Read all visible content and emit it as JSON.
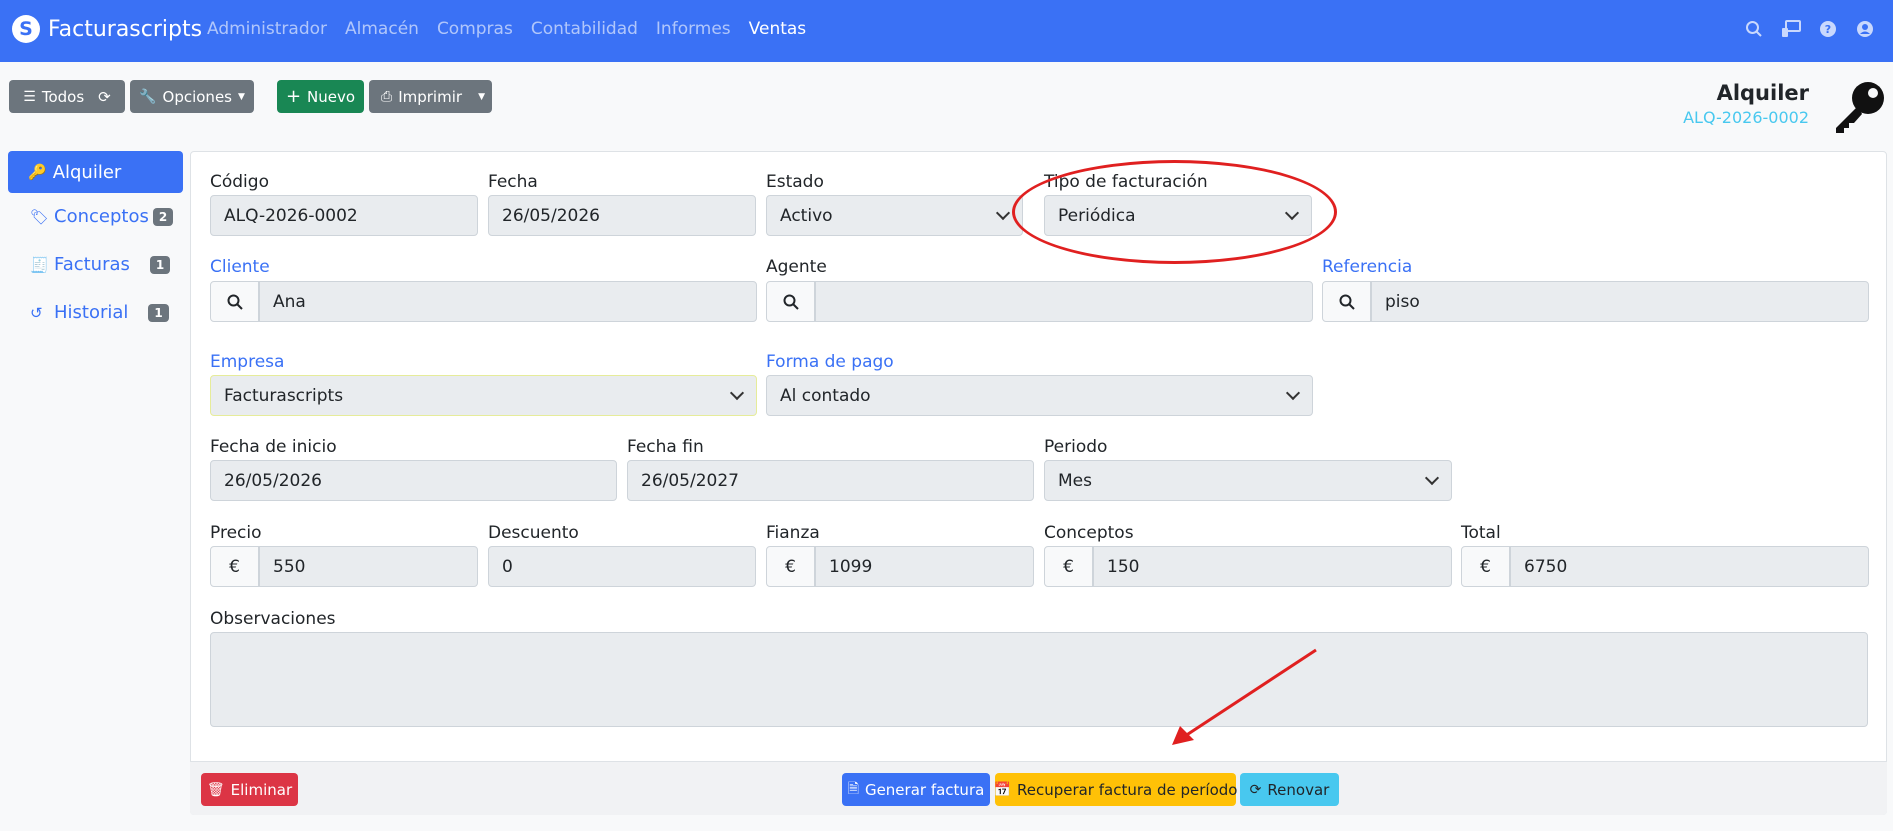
{
  "navbar": {
    "brand": "Facturascripts",
    "menu": [
      "Administrador",
      "Almacén",
      "Compras",
      "Contabilidad",
      "Informes",
      "Ventas"
    ],
    "active_menu": "Ventas",
    "icons": [
      "search-icon",
      "monitor-icon",
      "help-icon",
      "user-icon"
    ]
  },
  "toolbar": {
    "all_label": "Todos",
    "options_label": "Opciones",
    "new_label": "Nuevo",
    "print_label": "Imprimir"
  },
  "header": {
    "title": "Alquiler",
    "code": "ALQ-2026-0002"
  },
  "sidebar": {
    "items": [
      {
        "label": "Alquiler",
        "icon": "key-icon",
        "active": true
      },
      {
        "label": "Conceptos",
        "icon": "tags-icon",
        "badge": "2"
      },
      {
        "label": "Facturas",
        "icon": "invoice-icon",
        "badge": "1"
      },
      {
        "label": "Historial",
        "icon": "history-icon",
        "badge": "1"
      }
    ]
  },
  "form": {
    "codigo": {
      "label": "Código",
      "value": "ALQ-2026-0002"
    },
    "fecha": {
      "label": "Fecha",
      "value": "26/05/2026"
    },
    "estado": {
      "label": "Estado",
      "value": "Activo"
    },
    "tipo_facturacion": {
      "label": "Tipo de facturación",
      "value": "Periódica"
    },
    "cliente": {
      "label": "Cliente",
      "value": "Ana"
    },
    "agente": {
      "label": "Agente",
      "value": ""
    },
    "referencia": {
      "label": "Referencia",
      "value": "piso"
    },
    "empresa": {
      "label": "Empresa",
      "value": "Facturascripts"
    },
    "forma_pago": {
      "label": "Forma de pago",
      "value": "Al contado"
    },
    "fecha_inicio": {
      "label": "Fecha de inicio",
      "value": "26/05/2026"
    },
    "fecha_fin": {
      "label": "Fecha fin",
      "value": "26/05/2027"
    },
    "periodo": {
      "label": "Periodo",
      "value": "Mes"
    },
    "precio": {
      "label": "Precio",
      "value": "550"
    },
    "descuento": {
      "label": "Descuento",
      "value": "0"
    },
    "fianza": {
      "label": "Fianza",
      "value": "1099"
    },
    "conceptos": {
      "label": "Conceptos",
      "value": "150"
    },
    "total": {
      "label": "Total",
      "value": "6750"
    },
    "observaciones": {
      "label": "Observaciones",
      "value": ""
    },
    "currency_symbol": "€"
  },
  "footer": {
    "delete_label": "Eliminar",
    "generate_label": "Generar factura",
    "recover_label": "Recuperar factura de período",
    "renew_label": "Renovar"
  },
  "colors": {
    "primary": "#3a71f5",
    "success": "#198754",
    "danger": "#dc3545",
    "warning": "#ffc107",
    "info": "#48c8ef",
    "annotation": "#e02020"
  }
}
